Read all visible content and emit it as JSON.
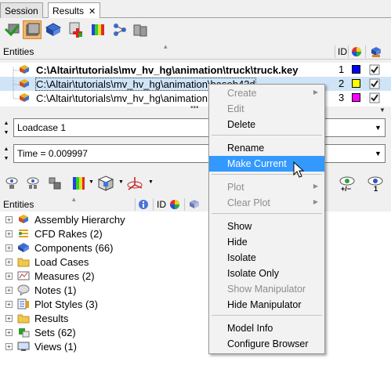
{
  "tabs": [
    {
      "label": "Session"
    },
    {
      "label": "Results"
    }
  ],
  "tab_close_glyph": "✕",
  "toolbar": {
    "icons": [
      "import-model-icon",
      "model-view-icon",
      "result-icon",
      "add-icon",
      "contour-icon",
      "network-icon",
      "cylinders-icon"
    ]
  },
  "files_panel": {
    "header": "Entities",
    "id_header": "ID",
    "rows": [
      {
        "path": "C:\\Altair\\tutorials\\mv_hv_hg\\animation\\truck\\truck.key",
        "id": "1",
        "color": "#0000ff",
        "bold": true
      },
      {
        "path": "C:\\Altair\\tutorials\\mv_hv_hg\\animation\\baseb43d",
        "id": "2",
        "color": "#ffff00",
        "bold": false
      },
      {
        "path": "C:\\Altair\\tutorials\\mv_hv_hg\\animation",
        "id": "3",
        "color": "#ff00ff",
        "bold": false
      }
    ]
  },
  "loadcase": {
    "value": "Loadcase 1"
  },
  "time": {
    "value": "Time = 0.009997"
  },
  "eye_labels": {
    "plus_minus": "+/−",
    "one": "1"
  },
  "entities_panel": {
    "header": "Entities",
    "id_header": "ID",
    "items": [
      {
        "label": "Assembly Hierarchy",
        "icon": "assembly-icon"
      },
      {
        "label": "CFD Rakes (2)",
        "icon": "cfd-rakes-icon"
      },
      {
        "label": "Components (66)",
        "icon": "components-icon"
      },
      {
        "label": "Load Cases",
        "icon": "folder-icon"
      },
      {
        "label": "Measures (2)",
        "icon": "measures-icon"
      },
      {
        "label": "Notes (1)",
        "icon": "notes-icon"
      },
      {
        "label": "Plot Styles (3)",
        "icon": "plot-styles-icon"
      },
      {
        "label": "Results",
        "icon": "folder-icon"
      },
      {
        "label": "Sets  (62)",
        "icon": "sets-icon"
      },
      {
        "label": "Views (1)",
        "icon": "views-icon"
      }
    ]
  },
  "context_menu": {
    "items": [
      {
        "label": "Create",
        "disabled": true,
        "submenu": true
      },
      {
        "label": "Edit",
        "disabled": true,
        "submenu": false
      },
      {
        "label": "Delete",
        "disabled": false,
        "submenu": false
      },
      {
        "sep": true
      },
      {
        "label": "Rename",
        "disabled": false,
        "submenu": false
      },
      {
        "label": "Make Current",
        "disabled": false,
        "submenu": false,
        "highlighted": true
      },
      {
        "sep": true
      },
      {
        "label": "Plot",
        "disabled": true,
        "submenu": true
      },
      {
        "label": "Clear Plot",
        "disabled": true,
        "submenu": true
      },
      {
        "sep": true
      },
      {
        "label": "Show",
        "disabled": false,
        "submenu": false
      },
      {
        "label": "Hide",
        "disabled": false,
        "submenu": false
      },
      {
        "label": "Isolate",
        "disabled": false,
        "submenu": false
      },
      {
        "label": "Isolate Only",
        "disabled": false,
        "submenu": false
      },
      {
        "label": "Show Manipulator",
        "disabled": true,
        "submenu": false
      },
      {
        "label": "Hide Manipulator",
        "disabled": false,
        "submenu": false
      },
      {
        "sep": true
      },
      {
        "label": "Model Info",
        "disabled": false,
        "submenu": false
      },
      {
        "label": "Configure Browser",
        "disabled": false,
        "submenu": false
      }
    ]
  },
  "colors": {
    "selection": "#cfe4f7",
    "menu_highlight": "#3399ff",
    "pressed_button": "#f7b56a"
  }
}
